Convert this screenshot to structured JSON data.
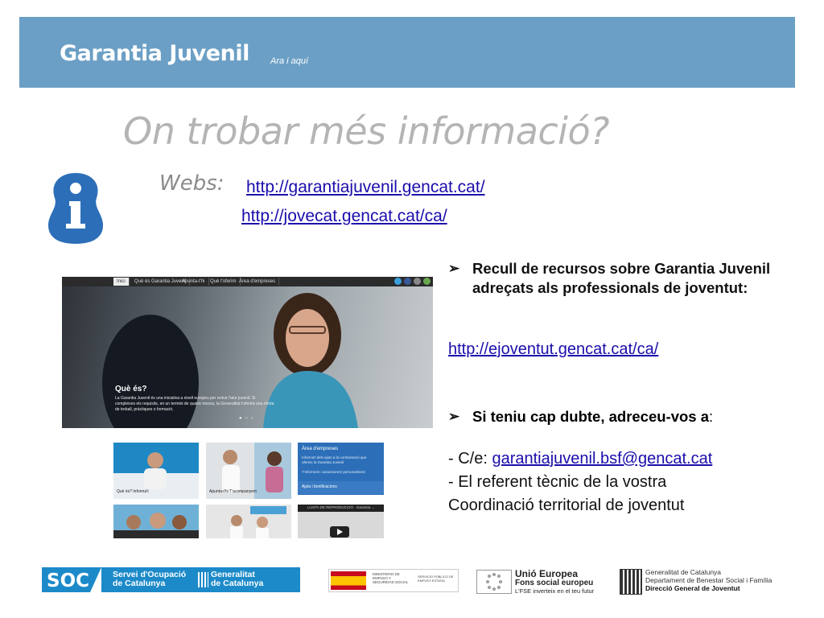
{
  "header": {
    "title": "Garantia Juvenil",
    "subtitle": "Ara i aquí",
    "color": "#6b9fc5"
  },
  "slide": {
    "title": "On trobar més informació?",
    "webs_label": "Webs:",
    "links": [
      "http://garantiajuvenil.gencat.cat/",
      "http://jovecat.gencat.cat/ca/"
    ],
    "bullet1": "Recull de recursos sobre Garantia Juvenil adreçats als professionals de joventut:",
    "link3": "http://ejoventut.gencat.cat/ca/",
    "bullet2": "Si teniu cap dubte, adreceu-vos a",
    "bullet2_colon": ":",
    "contact_prefix": "- C/e: ",
    "contact_email": "garantiajuvenil.bsf@gencat.cat",
    "contact_line2": "- El referent tècnic de la vostra",
    "contact_line3": "Coordinació territorial de joventut"
  },
  "website_shot": {
    "nav": [
      "Inici",
      "Què és Garantia Juvenil",
      "Apunta-t'hi",
      "Què t'oferim",
      "Àrea d'empreses"
    ],
    "heading": "Què és?",
    "text": "La Garantia Juvenil és una iniciativa a nivell europeu per reduir l'atur juvenil. Si compleixes els requisits, en un termini de quatre mesos, la Generalitat t'oferirà una oferta de treball, pràctiques o formació.",
    "thumb_labels": [
      "Què és? Informa't",
      "Apunta-t'hi T'acompanyem"
    ],
    "panel_title": "Àrea d'empreses",
    "panel_text": "Informa't dels ajuts a la contractació que ofereix la Garantia Juvenil",
    "panel_sub": "T'informem i assessorem personalment",
    "panel2": "Ajuts i bonificacions",
    "video_bar": "LLISTA DE REPRODUCCIÓ · Garantia ..."
  },
  "footer": {
    "soc": "SOC",
    "soc_name_1": "Servei d'Ocupació",
    "soc_name_2": "de Catalunya",
    "gen_1": "Generalitat",
    "gen_2": "de Catalunya",
    "ministry": "MINISTERIO DE EMPLEO Y SEGURIDAD SOCIAL",
    "ministry_2": "SERVICIO PÚBLICO DE EMPLEO ESTATAL",
    "eu_1": "Unió Europea",
    "eu_2": "Fons social europeu",
    "eu_3": "L'FSE inverteix en el teu futur",
    "gencat_1": "Generalitat de Catalunya",
    "gencat_2": "Departament de Benestar Social i Família",
    "gencat_3": "Direcció General de Joventut"
  }
}
